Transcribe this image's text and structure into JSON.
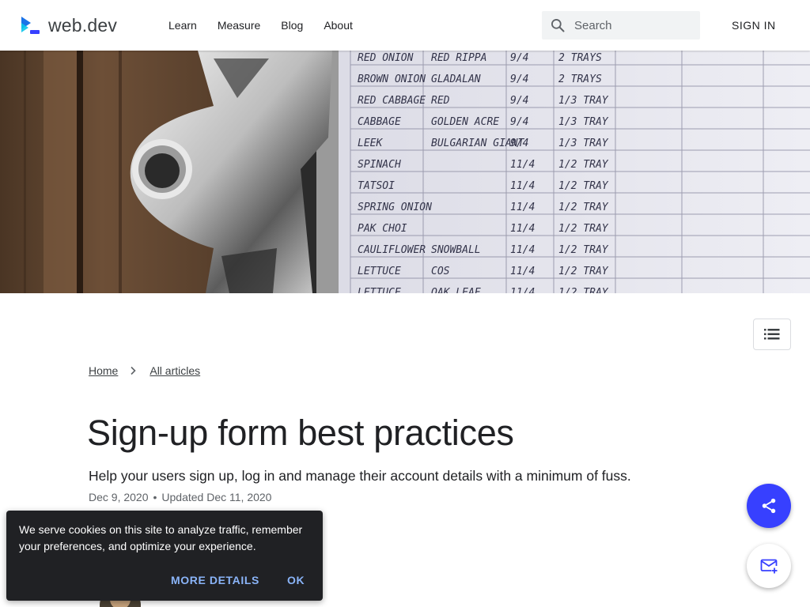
{
  "header": {
    "brand": "web.dev",
    "nav": [
      "Learn",
      "Measure",
      "Blog",
      "About"
    ],
    "search_placeholder": "Search",
    "sign_in": "SIGN IN"
  },
  "hero": {
    "description": "Clipboard holding a handwritten seed planting list",
    "rows": [
      [
        "RED ONION",
        "RED RIPPA",
        "9/4",
        "2 TRAYS"
      ],
      [
        "BROWN ONION",
        "GLADALAN",
        "9/4",
        "2 TRAYS"
      ],
      [
        "RED CABBAGE",
        "RED",
        "9/4",
        "1/3 TRAY"
      ],
      [
        "CABBAGE",
        "GOLDEN ACRE",
        "9/4",
        "1/3 TRAY"
      ],
      [
        "LEEK",
        "BULGARIAN GIANT",
        "9/4",
        "1/3 TRAY"
      ],
      [
        "SPINACH",
        "",
        "11/4",
        "1/2 TRAY"
      ],
      [
        "TATSOI",
        "",
        "11/4",
        "1/2 TRAY"
      ],
      [
        "SPRING ONION",
        "",
        "11/4",
        "1/2 TRAY"
      ],
      [
        "PAK CHOI",
        "",
        "11/4",
        "1/2 TRAY"
      ],
      [
        "CAULIFLOWER",
        "SNOWBALL",
        "11/4",
        "1/2 TRAY"
      ],
      [
        "LETTUCE",
        "COS",
        "11/4",
        "1/2 TRAY"
      ],
      [
        "LETTUCE",
        "OAK LEAF",
        "11/4",
        "1/2 TRAY"
      ]
    ]
  },
  "breadcrumb": [
    "Home",
    "All articles"
  ],
  "article": {
    "title": "Sign-up form best practices",
    "subtitle": "Help your users sign up, log in and manage their account details with a minimum of fuss.",
    "published": "Dec 9, 2020",
    "separator": "•",
    "updated": "Updated Dec 11, 2020"
  },
  "cookie": {
    "text": "We serve cookies on this site to analyze traffic, remember your preferences, and optimize your experience.",
    "more": "MORE DETAILS",
    "ok": "OK"
  },
  "icons": {
    "toc": "list-icon",
    "share": "share-icon",
    "subscribe": "mail-add-icon",
    "search": "search-icon",
    "chevron": "chevron-right-icon"
  },
  "colors": {
    "accent": "#3740ff",
    "cookie_bg": "#202124",
    "cookie_link": "#8ab4f8"
  }
}
